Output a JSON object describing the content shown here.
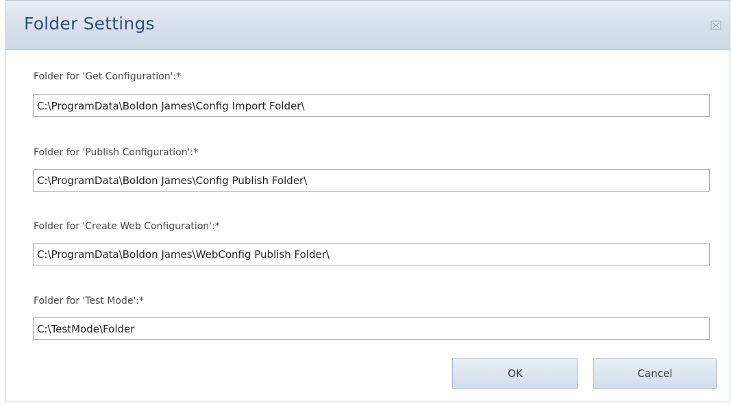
{
  "dialog": {
    "title": "Folder Settings",
    "close_icon": "close-icon"
  },
  "fields": [
    {
      "label": "Folder for 'Get Configuration':*",
      "value": "C:\\ProgramData\\Boldon James\\Config Import Folder\\"
    },
    {
      "label": "Folder for 'Publish Configuration':*",
      "value": "C:\\ProgramData\\Boldon James\\Config Publish Folder\\"
    },
    {
      "label": "Folder for 'Create Web Configuration':*",
      "value": "C:\\ProgramData\\Boldon James\\WebConfig Publish Folder\\"
    },
    {
      "label": "Folder for 'Test Mode':*",
      "value": "C:\\TestMode\\Folder"
    }
  ],
  "buttons": {
    "ok_label": "OK",
    "cancel_label": "Cancel"
  },
  "colors": {
    "title_text": "#2e4f7a",
    "titlebar_bg": "#d6e0ec",
    "button_bg": "#dce5f0"
  }
}
